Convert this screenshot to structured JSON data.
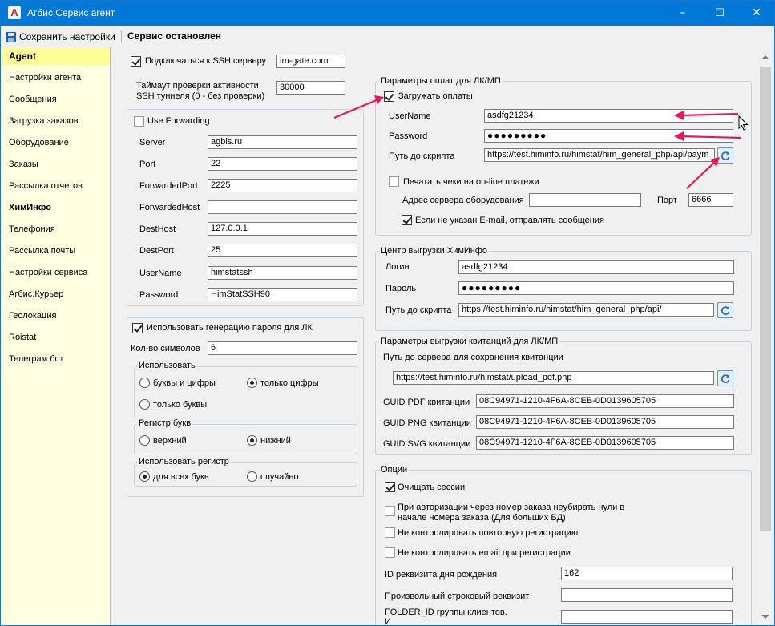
{
  "window": {
    "title": "Агбис.Сервис агент",
    "minimize": "–",
    "maximize": "☐",
    "close": "✕"
  },
  "toolbar": {
    "save_label": "Сохранить настройки",
    "status": "Сервис остановлен"
  },
  "sidebar": {
    "items": [
      {
        "label": "Agent"
      },
      {
        "label": "Настройки агента"
      },
      {
        "label": "Сообщения"
      },
      {
        "label": "Загрузка заказов"
      },
      {
        "label": "Оборудование"
      },
      {
        "label": "Заказы"
      },
      {
        "label": "Рассылка отчетов"
      },
      {
        "label": "ХимИнфо"
      },
      {
        "label": "Телефония"
      },
      {
        "label": "Рассылка почты"
      },
      {
        "label": "Настройки сервиса"
      },
      {
        "label": "Агбис.Курьер"
      },
      {
        "label": "Геолокация"
      },
      {
        "label": "Roistat"
      },
      {
        "label": "Телеграм бот"
      }
    ]
  },
  "ssh": {
    "connect_label": "Подключаться к SSH серверу",
    "connect_checked": true,
    "server": "im-gate.com",
    "timeout_label_1": "Таймаут проверки активности",
    "timeout_label_2": "SSH туннеля (0 - без проверки)",
    "timeout": "30000",
    "use_forwarding_label": "Use Forwarding",
    "use_forwarding_checked": false,
    "fields": [
      {
        "label": "Server",
        "value": "agbis.ru"
      },
      {
        "label": "Port",
        "value": "22"
      },
      {
        "label": "ForwardedPort",
        "value": "2225"
      },
      {
        "label": "ForwardedHost",
        "value": ""
      },
      {
        "label": "DestHost",
        "value": "127.0.0.1"
      },
      {
        "label": "DestPort",
        "value": "25"
      },
      {
        "label": "UserName",
        "value": "himstatssh"
      },
      {
        "label": "Password",
        "value": "HimStatSSH90"
      }
    ]
  },
  "pwgen": {
    "use_label": "Использовать генерацию пароля для ЛК",
    "use_checked": true,
    "count_label": "Кол-во символов",
    "count": "6",
    "use_group": "Использовать",
    "opt_letters_digits": "буквы и цифры",
    "opt_digits": "только цифры",
    "opt_letters": "только буквы",
    "case_group": "Регистр букв",
    "opt_upper": "верхний",
    "opt_lower": "нижний",
    "reg_group": "Использовать регистр",
    "opt_all": "для всех букв",
    "opt_random": "случайно"
  },
  "payments": {
    "group": "Параметры оплат для ЛК/МП",
    "load_label": "Загружать оплаты",
    "load_checked": true,
    "user_label": "UserName",
    "user": "asdfg21234",
    "pass_label": "Password",
    "pass": "●●●●●●●●●",
    "script_label": "Путь до скрипта",
    "script": "https://test.himinfo.ru/himstat/him_general_php/api/paym",
    "print_label": "Печатать чеки на on-line платежи",
    "print_checked": false,
    "equip_label": "Адрес сервера оборудования",
    "equip": "",
    "port_label": "Порт",
    "port": "6666",
    "email_label": "Если не указан E-mail, отправлять сообщения",
    "email_checked": true
  },
  "unload": {
    "group": "Центр выгрузки ХимИнфо",
    "login_label": "Логин",
    "login": "asdfg21234",
    "pass_label": "Пароль",
    "pass": "●●●●●●●●●",
    "script_label": "Путь до скрипта",
    "script": "https://test.himinfo.ru/himstat/him_general_php/api/"
  },
  "receipts": {
    "group": "Параметры выгрузки квитанций для ЛК/МП",
    "path_label": "Путь до сервера для сохранения квитанции",
    "path": "https://test.himinfo.ru/himstat/upload_pdf.php",
    "pdf_label": "GUID PDF квитанции",
    "pdf": "08C94971-1210-4F6A-8CEB-0D0139605705",
    "png_label": "GUID PNG квитанции",
    "png": "08C94971-1210-4F6A-8CEB-0D0139605705",
    "svg_label": "GUID SVG квитанции",
    "svg": "08C94971-1210-4F6A-8CEB-0D0139605705"
  },
  "options": {
    "group": "Опции",
    "clear_label": "Очищать сессии",
    "clear_checked": true,
    "zero_label_1": "При авторизации через номер заказа неубирать нули в",
    "zero_label_2": "начале номера заказа (Для больших БД)",
    "repeat_label": "Не контролировать повторную регистрацию",
    "email_label": "Не контролировать email при регистрации",
    "bday_label": "ID реквизита дня рождения",
    "bday": "162",
    "str_label": "Произвольный строковый реквизит",
    "str": "",
    "folder_label": "FOLDER_ID группы клиентов.",
    "folder_label_2": "И"
  },
  "colors": {
    "titlebar": "#0078d7",
    "sidebar": "#ffffe1",
    "sidebar_active": "#ffff99",
    "annotation_arrow": "#e8175d"
  }
}
